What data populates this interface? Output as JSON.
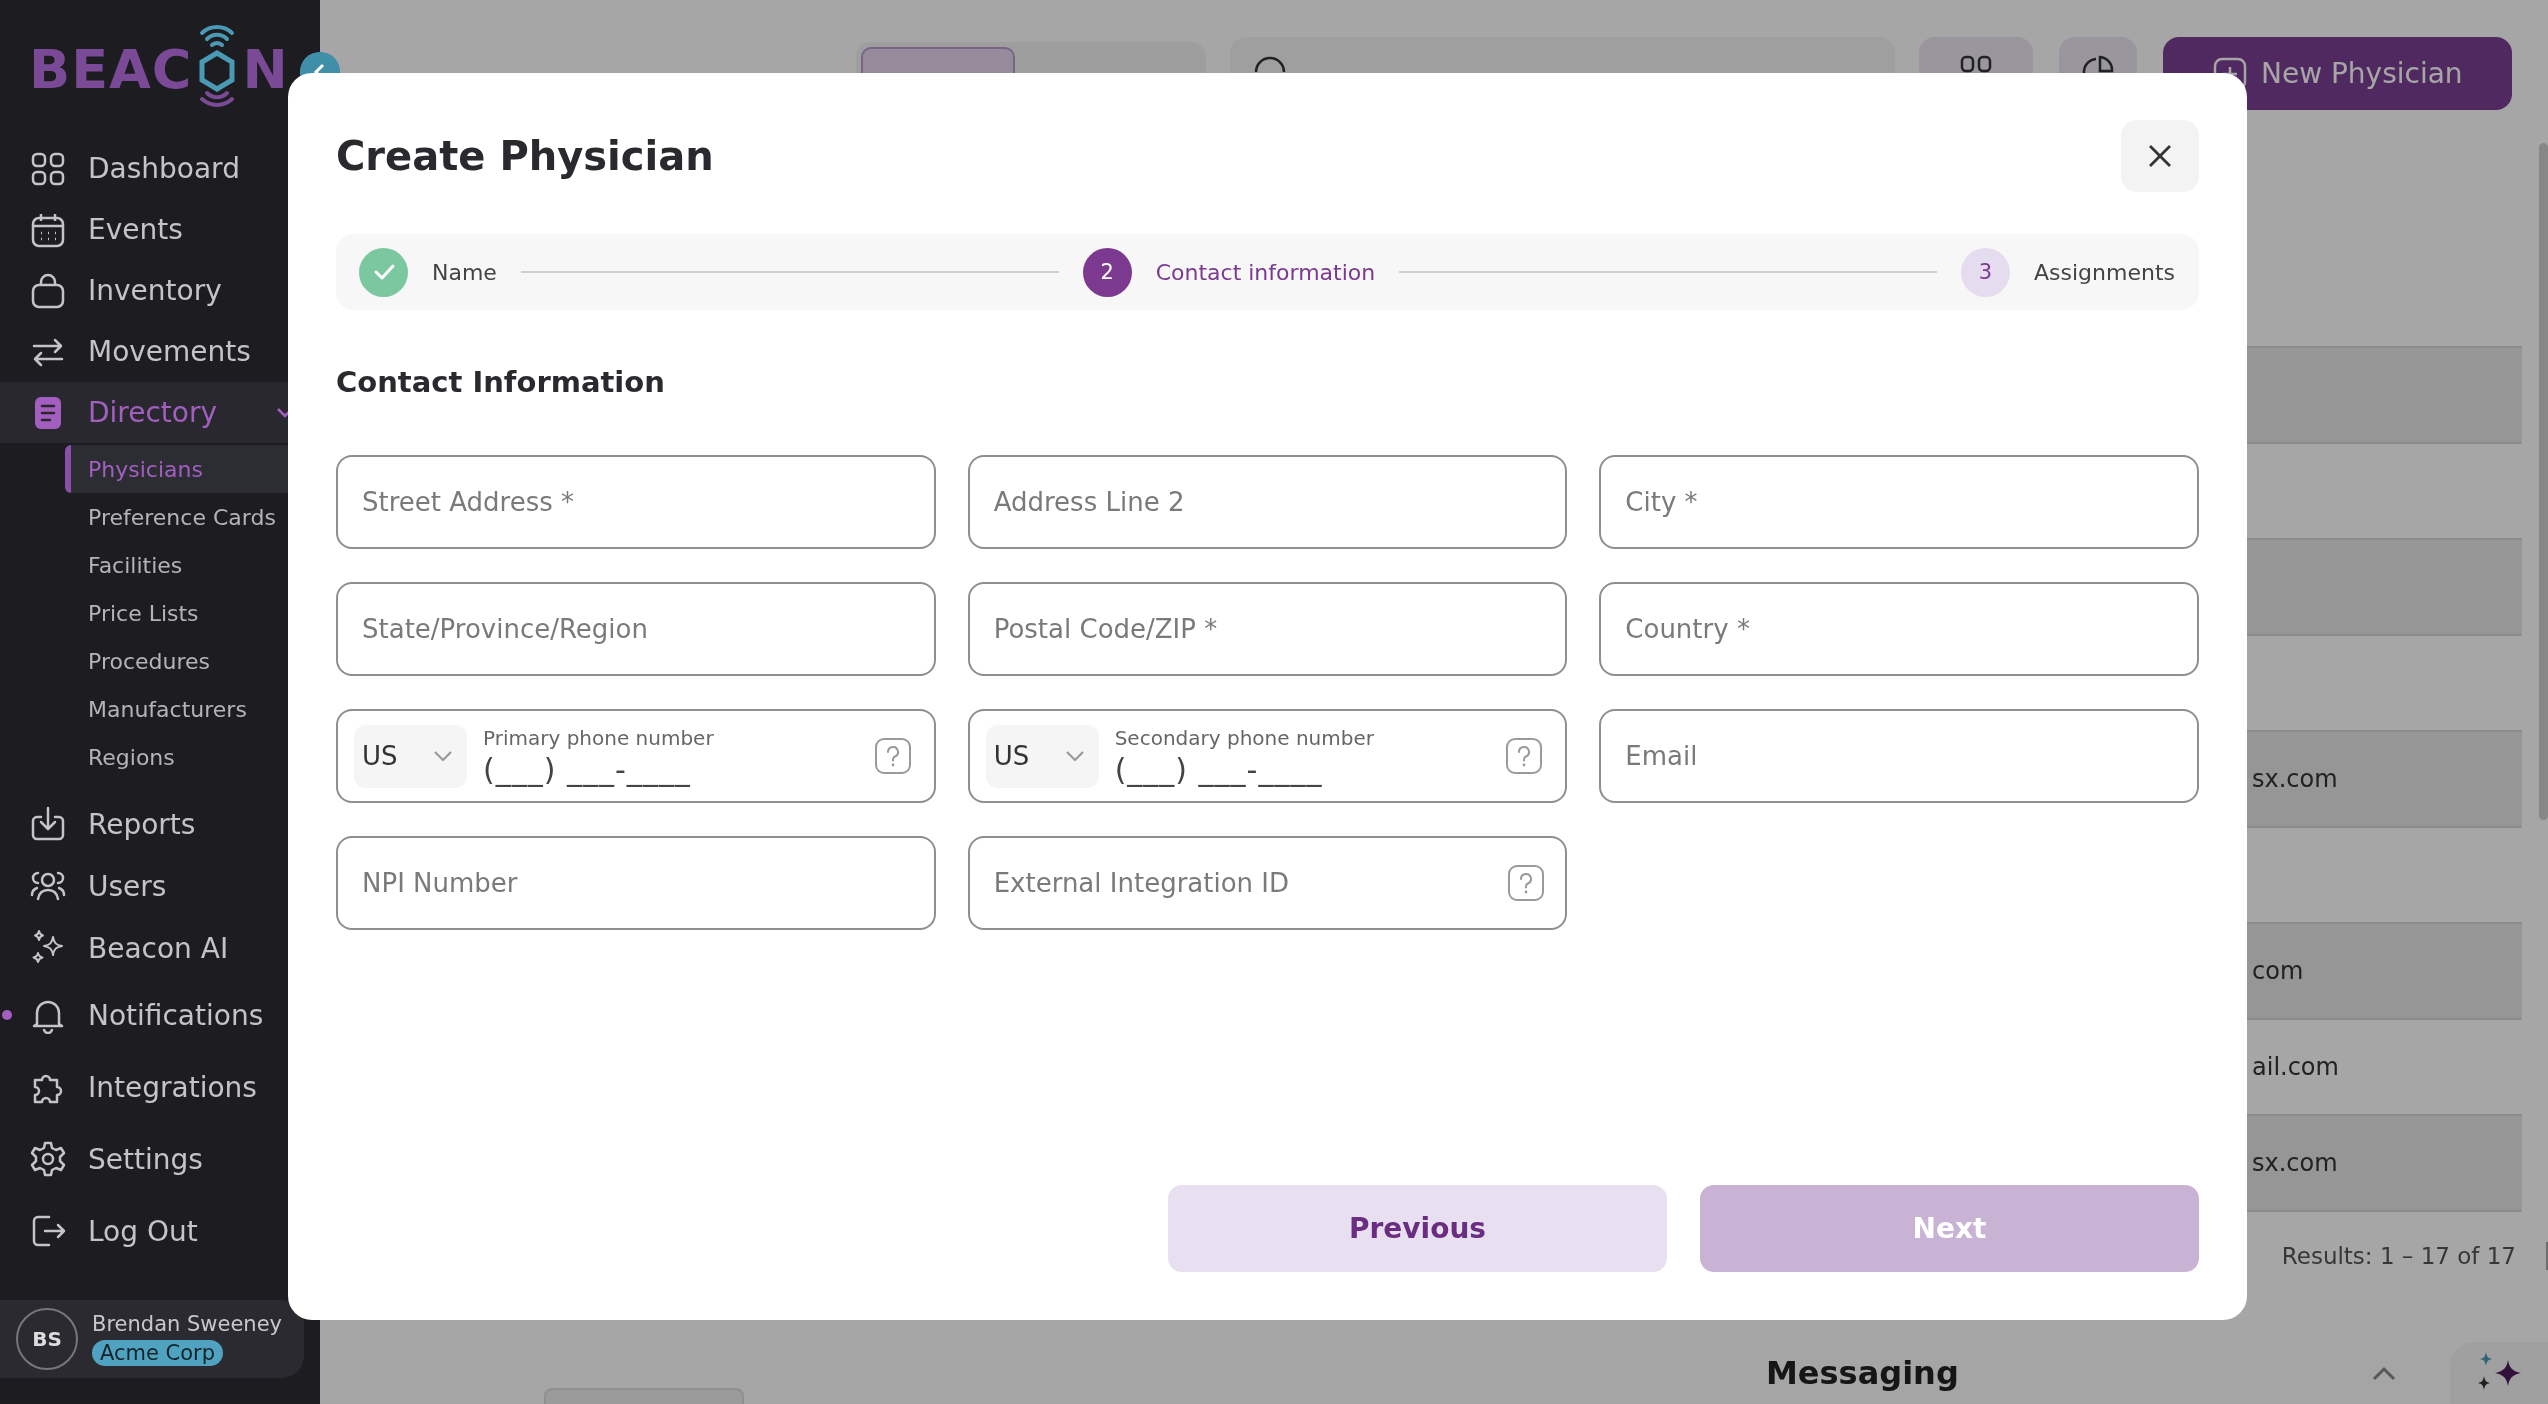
{
  "sidebar": {
    "logo": {
      "lead": "BEAC",
      "tail": "N"
    },
    "nav": [
      {
        "label": "Dashboard",
        "selected": false
      },
      {
        "label": "Events",
        "selected": false
      },
      {
        "label": "Inventory",
        "selected": false
      },
      {
        "label": "Movements",
        "selected": false
      },
      {
        "label": "Directory",
        "selected": true,
        "expanded": true,
        "children": [
          {
            "label": "Physicians",
            "selected": true
          },
          {
            "label": "Preference Cards",
            "selected": false
          },
          {
            "label": "Facilities",
            "selected": false
          },
          {
            "label": "Price Lists",
            "selected": false
          },
          {
            "label": "Procedures",
            "selected": false
          },
          {
            "label": "Manufacturers",
            "selected": false
          },
          {
            "label": "Regions",
            "selected": false
          }
        ]
      }
    ],
    "nav_lower": [
      {
        "label": "Reports",
        "selected": false
      },
      {
        "label": "Users",
        "selected": false
      },
      {
        "label": "Beacon AI",
        "selected": false
      }
    ],
    "nav_bottom": [
      {
        "label": "Notifications",
        "selected": false,
        "unread": true
      },
      {
        "label": "Integrations",
        "selected": false,
        "unread": false
      },
      {
        "label": "Settings",
        "selected": false,
        "unread": false
      },
      {
        "label": "Log Out",
        "selected": false,
        "unread": false
      }
    ],
    "user": {
      "initials": "BS",
      "name": "Brendan Sweeney",
      "org": "Acme Corp"
    }
  },
  "page": {
    "tabs": [
      {
        "selected": true
      },
      {
        "selected": false
      }
    ],
    "new_button": "New Physician",
    "table": {
      "rows": [
        {
          "shaded": false
        },
        {
          "shaded": true
        },
        {
          "shaded": false
        },
        {
          "shaded": true
        },
        {
          "shaded": false
        },
        {
          "shaded": true,
          "cell_text": "sx.com"
        },
        {
          "shaded": false
        },
        {
          "shaded": true,
          "cell_text": "com"
        },
        {
          "shaded": false,
          "cell_text": "ail.com"
        },
        {
          "shaded": true,
          "cell_text": "sx.com"
        }
      ]
    },
    "results": "Results: 1 – 17 of 17",
    "messaging": {
      "title": "Messaging"
    }
  },
  "dialog": {
    "title": "Create Physician",
    "stepper": {
      "steps": [
        {
          "label": "Name",
          "completed": true,
          "selected": false
        },
        {
          "number": "2",
          "label": "Contact information",
          "completed": false,
          "selected": true
        },
        {
          "number": "3",
          "label": "Assignments",
          "completed": false,
          "selected": false
        }
      ]
    },
    "section_title": "Contact Information",
    "fields": [
      {
        "kind": "text",
        "placeholder": "Street Address *",
        "help": false
      },
      {
        "kind": "text",
        "placeholder": "Address Line 2",
        "help": false
      },
      {
        "kind": "text",
        "placeholder": "City *",
        "help": false
      },
      {
        "kind": "text",
        "placeholder": "State/Province/Region",
        "help": false
      },
      {
        "kind": "text",
        "placeholder": "Postal Code/ZIP *",
        "help": false
      },
      {
        "kind": "text",
        "placeholder": "Country *",
        "help": false
      },
      {
        "kind": "phone",
        "country": "US",
        "label": "Primary phone number",
        "placeholder": "(___) ___-____",
        "help": true
      },
      {
        "kind": "phone",
        "country": "US",
        "label": "Secondary phone number",
        "placeholder": "(___) ___-____",
        "help": true
      },
      {
        "kind": "text",
        "placeholder": "Email",
        "help": false
      },
      {
        "kind": "text",
        "placeholder": "NPI Number",
        "help": false
      },
      {
        "kind": "text",
        "placeholder": "External Integration ID",
        "help": true
      }
    ],
    "buttons": [
      {
        "label": "Previous",
        "disabled": false
      },
      {
        "label": "Next",
        "disabled": true
      }
    ]
  }
}
